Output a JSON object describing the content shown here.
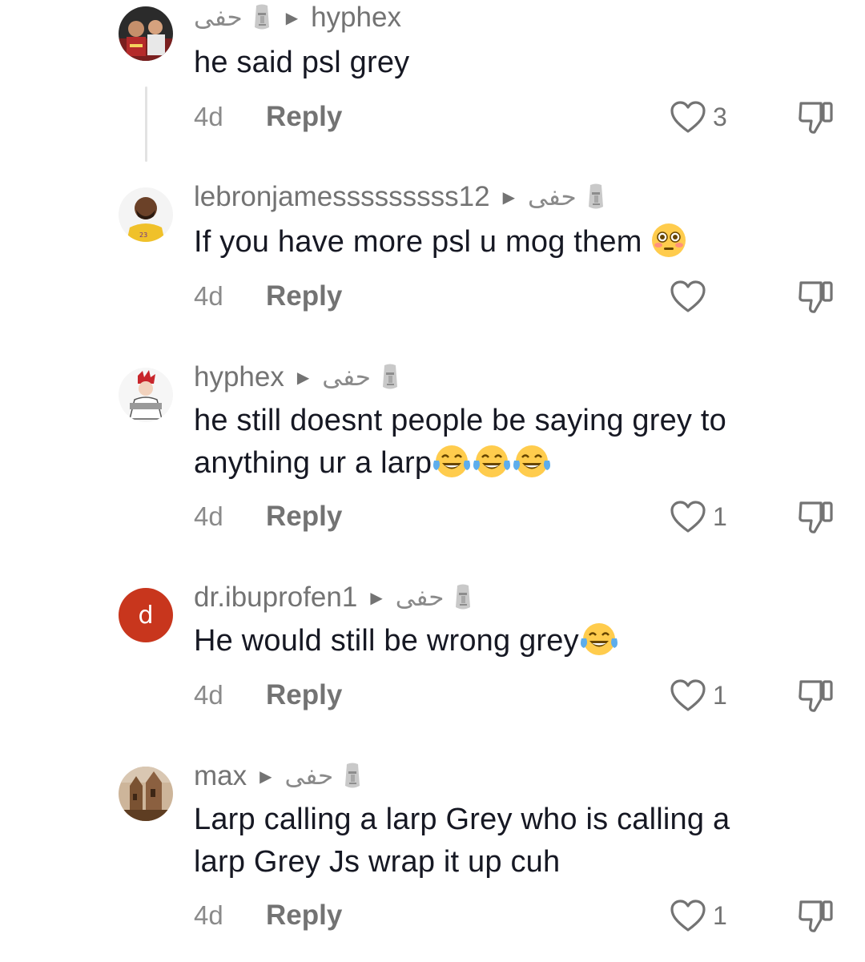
{
  "comments": [
    {
      "username": "",
      "reply_to": "hyphex",
      "display_tag": "حفى",
      "text": "he said psl grey",
      "time": "4d",
      "reply_label": "Reply",
      "likes": "3",
      "avatar": "photo-two-people-avatar"
    },
    {
      "username": "lebronjamesssssssss12",
      "reply_to": "حفى",
      "text": "If you have more psl u mog them",
      "emoji": "flushed-face-icon",
      "time": "4d",
      "reply_label": "Reply",
      "likes": "",
      "avatar": "basketball-player-avatar"
    },
    {
      "username": "hyphex",
      "reply_to": "حفى",
      "text_line1": "he still doesnt people be saying grey to",
      "text_line2": "anything ur a larp",
      "emoji": "tears-of-joy-icon x3",
      "time": "4d",
      "reply_label": "Reply",
      "likes": "1",
      "avatar": "anime-character-avatar"
    },
    {
      "username": "dr.ibuprofen1",
      "reply_to": "حفى",
      "text": "He would still be wrong grey",
      "emoji": "tears-of-joy-icon",
      "time": "4d",
      "reply_label": "Reply",
      "likes": "1",
      "avatar_letter": "d"
    },
    {
      "username": "max",
      "reply_to": "حفى",
      "text_line1": "Larp calling a larp Grey who is calling a",
      "text_line2": "larp Grey Js wrap it up cuh",
      "time": "4d",
      "reply_label": "Reply",
      "likes": "1",
      "avatar": "cathedral-photo-avatar"
    }
  ],
  "colors": {
    "text": "#161823",
    "muted": "#737373",
    "letter_avatar_bg": "#c8361d"
  },
  "icons": [
    "heart-icon",
    "dislike-icon",
    "moai-icon",
    "caret-right-icon"
  ]
}
